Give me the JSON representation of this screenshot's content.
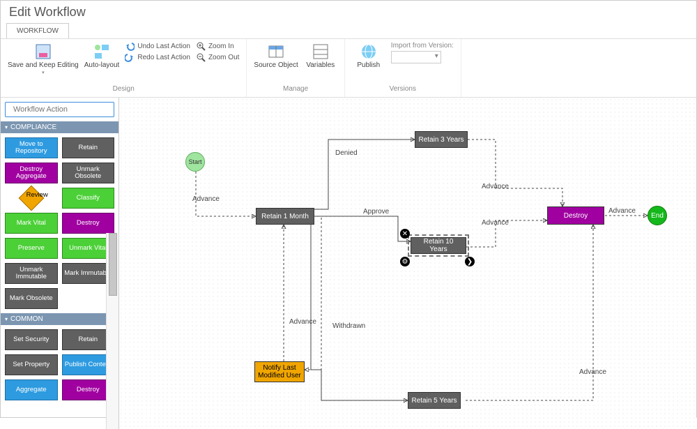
{
  "title": "Edit Workflow",
  "tabs": {
    "workflow": "WORKFLOW"
  },
  "ribbon": {
    "save": "Save and Keep Editing",
    "auto_layout": "Auto-layout",
    "undo": "Undo Last Action",
    "redo": "Redo Last Action",
    "zoom_in": "Zoom In",
    "zoom_out": "Zoom Out",
    "source_object": "Source Object",
    "variables": "Variables",
    "publish": "Publish",
    "import_label": "Import from Version:",
    "group_design": "Design",
    "group_manage": "Manage",
    "group_versions": "Versions"
  },
  "search": {
    "placeholder": "Workflow Action"
  },
  "categories": {
    "compliance": {
      "label": "COMPLIANCE",
      "items": {
        "move_repo": "Move to Repository",
        "retain": "Retain",
        "destroy_agg": "Destroy Aggregate",
        "unmark_obs": "Unmark Obsolete",
        "review": "Review",
        "classify": "Classify",
        "mark_vital": "Mark Vital",
        "destroy": "Destroy",
        "preserve": "Preserve",
        "unmark_vital": "Unmark Vital",
        "unmark_imm": "Unmark Immutable",
        "mark_imm": "Mark Immutable",
        "mark_obs": "Mark Obsolete"
      }
    },
    "common": {
      "label": "COMMON",
      "items": {
        "set_security": "Set Security",
        "retain": "Retain",
        "set_property": "Set Property",
        "publish_content": "Publish Content",
        "aggregate": "Aggregate",
        "destroy": "Destroy"
      }
    }
  },
  "nodes": {
    "start": "Start",
    "retain_1m": "Retain 1 Month",
    "retain_3y": "Retain 3 Years",
    "retain_10y": "Retain 10 Years",
    "retain_5y": "Retain 5 Years",
    "notify": "Notify Last Modified User",
    "destroy": "Destroy",
    "end": "End"
  },
  "edge_labels": {
    "advance": "Advance",
    "denied": "Denied",
    "approve": "Approve",
    "withdrawn": "Withdrawn"
  }
}
